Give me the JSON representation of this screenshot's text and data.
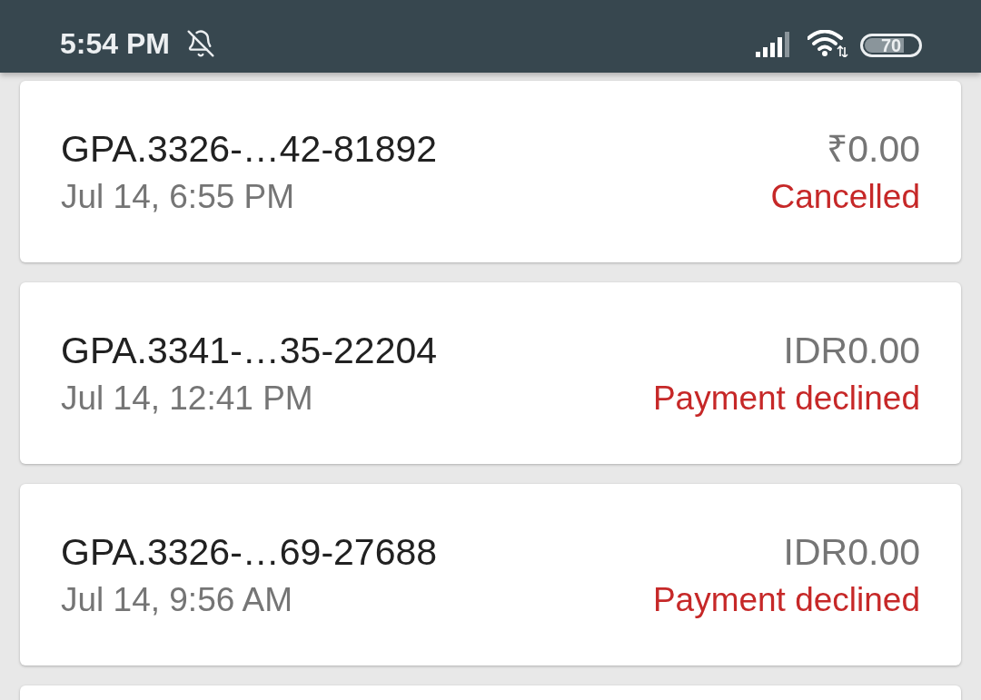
{
  "status_bar": {
    "time": "5:54 PM",
    "battery": "70"
  },
  "transactions": [
    {
      "id": "GPA.3326-…42-81892",
      "date": "Jul 14, 6:55 PM",
      "amount": "₹0.00",
      "status": "Cancelled"
    },
    {
      "id": "GPA.3341-…35-22204",
      "date": "Jul 14, 12:41 PM",
      "amount": "IDR0.00",
      "status": "Payment declined"
    },
    {
      "id": "GPA.3326-…69-27688",
      "date": "Jul 14, 9:56 AM",
      "amount": "IDR0.00",
      "status": "Payment declined"
    }
  ]
}
